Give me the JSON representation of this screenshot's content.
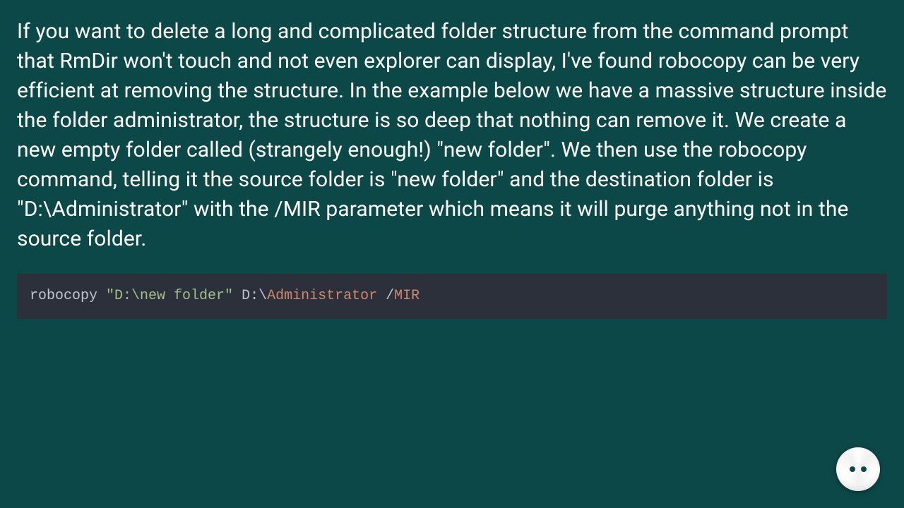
{
  "article": {
    "paragraph": "If you want to delete a long and complicated folder structure from the command prompt that RmDir won't touch and not even explorer can display, I've found robocopy can be very efficient at removing the structure. In the example below we have a massive structure inside the folder administrator, the structure is so deep that nothing can remove it. We create a new empty folder called (strangely enough!) \"new folder\". We then use the robocopy command, telling it the source folder is \"new folder\" and the destination folder is \"D:\\Administrator\" with the /MIR parameter which means it will purge anything not in the source folder."
  },
  "code": {
    "cmd": "robocopy ",
    "src": "\"D:\\new folder\"",
    "sep": " ",
    "dst_prefix": "D:\\",
    "dst_rest": "Administrator",
    "sep2": " /",
    "flag": "MIR"
  },
  "widget": {
    "name": "chat-assistant"
  }
}
